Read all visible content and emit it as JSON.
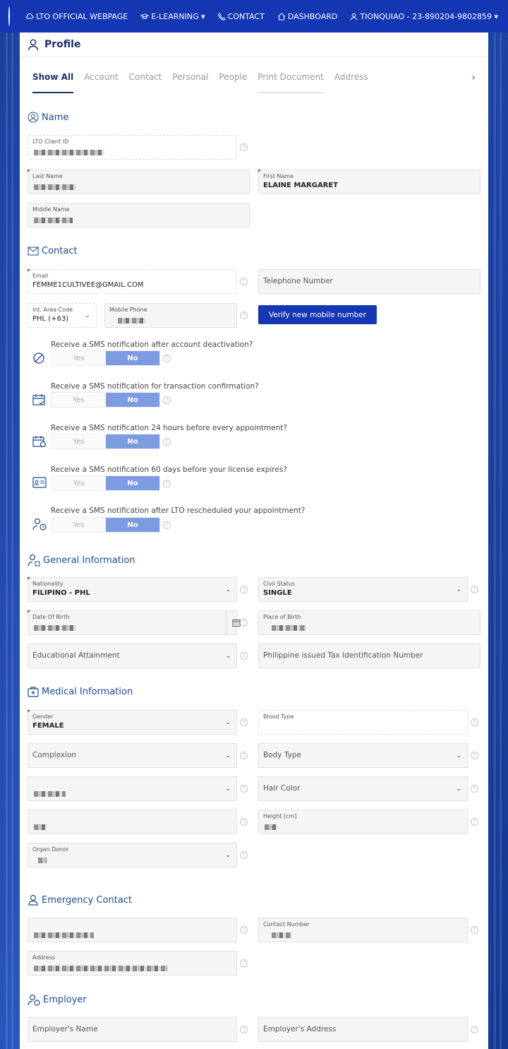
{
  "nav": {
    "items": [
      {
        "label": "LTO OFFICIAL WEBPAGE",
        "icon": "cloud-icon"
      },
      {
        "label": "E-LEARNING",
        "icon": "graduation-cap-icon"
      },
      {
        "label": "CONTACT",
        "icon": "phone-icon"
      },
      {
        "label": "DASHBOARD",
        "icon": "home-icon"
      },
      {
        "label": "TIONQUIAO - 23-890204-9802859",
        "icon": "user-icon"
      }
    ]
  },
  "profile": {
    "title": "Profile"
  },
  "tabs": [
    "Show All",
    "Account",
    "Contact",
    "Personal",
    "People",
    "Print Document",
    "Address"
  ],
  "sections": {
    "name": "Name",
    "contact": "Contact",
    "general": "General Information",
    "medical": "Medical Information",
    "emergency": "Emergency Contact",
    "employer": "Employer"
  },
  "name": {
    "client_id_label": "LTO Client ID",
    "last_name_label": "Last Name",
    "first_name_label": "First Name",
    "first_name_value": "ELAINE MARGARET",
    "middle_name_label": "Middle Name"
  },
  "contact": {
    "email_label": "Email",
    "email_value": "FEMME1CULTIVEE@GMAIL.COM",
    "telephone_placeholder": "Telephone Number",
    "area_code_label": "Int. Area Code",
    "area_code_value": "PHL (+63)",
    "mobile_label": "Mobile Phone",
    "verify_label": "Verify new mobile number"
  },
  "notifications": [
    {
      "question": "Receive a SMS notification after account deactivation?",
      "icon": "ban-icon"
    },
    {
      "question": "Receive a SMS notification for transaction confirmation?",
      "icon": "calendar-check-icon"
    },
    {
      "question": "Receive a SMS notification 24 hours before every appointment?",
      "icon": "calendar-clock-icon"
    },
    {
      "question": "Receive a SMS notification 60 days before your license expires?",
      "icon": "id-card-icon"
    },
    {
      "question": "Receive a SMS notification after LTO rescheduled your appointment?",
      "icon": "user-clock-icon"
    }
  ],
  "toggle": {
    "yes": "Yes",
    "no": "No",
    "selected": "No"
  },
  "general": {
    "nationality_label": "Nationality",
    "nationality_value": "FILIPINO - PHL",
    "civil_status_label": "Civil Status",
    "civil_status_value": "SINGLE",
    "dob_label": "Date Of Birth",
    "pob_label": "Place of Birth",
    "education_placeholder": "Educational Attainment",
    "tin_placeholder": "Philippine issued Tax Identification Number"
  },
  "medical": {
    "gender_label": "Gender",
    "gender_value": "FEMALE",
    "blood_type_label": "Blood Type",
    "complexion_placeholder": "Complexion",
    "body_type_placeholder": "Body Type",
    "hair_color_placeholder": "Hair Color",
    "height_label": "Height [cm]",
    "organ_donor_label": "Organ Donor"
  },
  "emergency": {
    "contact_number_label": "Contact Number",
    "address_label": "Address"
  },
  "employer": {
    "name_placeholder": "Employer's Name",
    "address_placeholder": "Employer's Address"
  },
  "colors": {
    "nav_bg": "#1537b3",
    "accent": "#1c3266",
    "toggle_selected": "#7d9be0",
    "required": "#d32f2f"
  }
}
